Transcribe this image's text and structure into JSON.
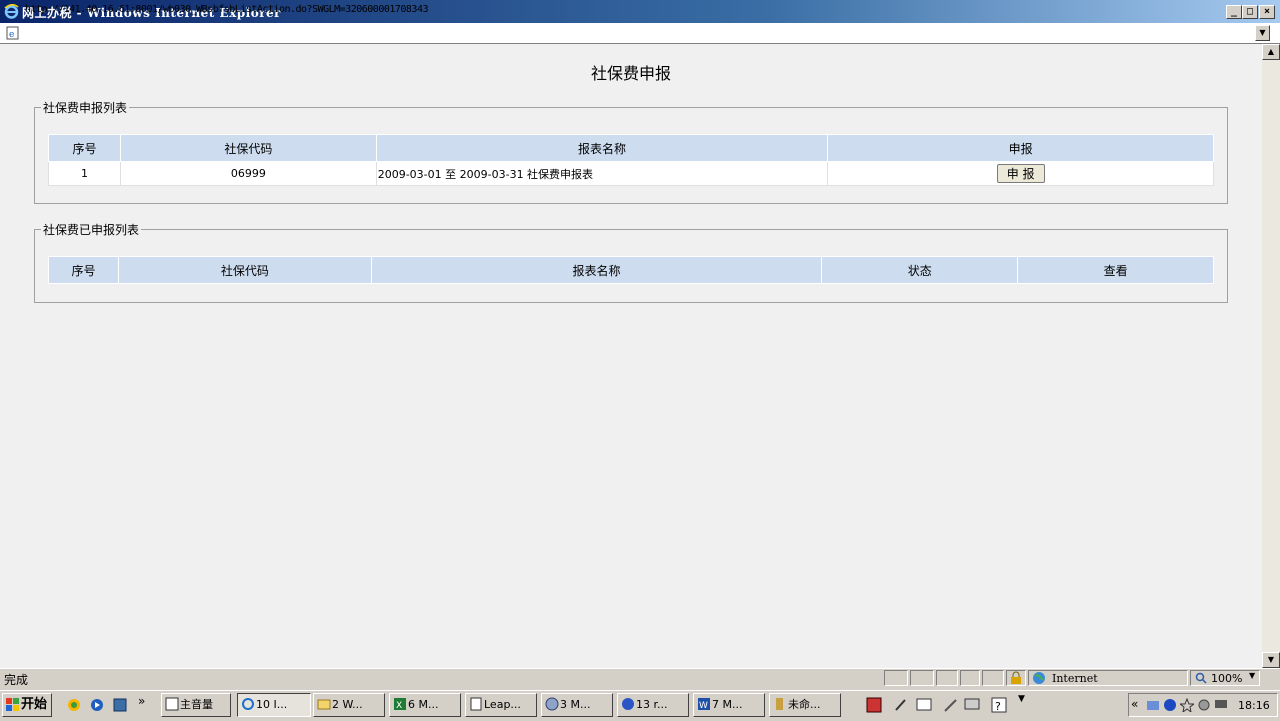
{
  "window": {
    "title": "网上办税 - Windows Internet Explorer"
  },
  "address": {
    "url": "http://141.40.16.61:8001/wb030_WBsbfsbListAction.do?SWGLM=320600001708343"
  },
  "page": {
    "title": "社保费申报",
    "pending": {
      "legend": "社保费申报列表",
      "headers": [
        "序号",
        "社保代码",
        "报表名称",
        "申报"
      ],
      "rows": [
        {
          "seq": "1",
          "code": "06999",
          "name": "2009-03-01 至 2009-03-31 社保费申报表",
          "action": "申 报"
        }
      ]
    },
    "declared": {
      "legend": "社保费已申报列表",
      "headers": [
        "序号",
        "社保代码",
        "报表名称",
        "状态",
        "查看"
      ]
    }
  },
  "status": {
    "text": "完成",
    "zone": "Internet",
    "zoom": "100%"
  },
  "taskbar": {
    "start": "开始",
    "items": [
      "主音量",
      "10 I...",
      "2 W...",
      "6 M...",
      "Leap...",
      "3 M...",
      "13 r...",
      "7 M...",
      "未命..."
    ],
    "clock": "18:16"
  }
}
